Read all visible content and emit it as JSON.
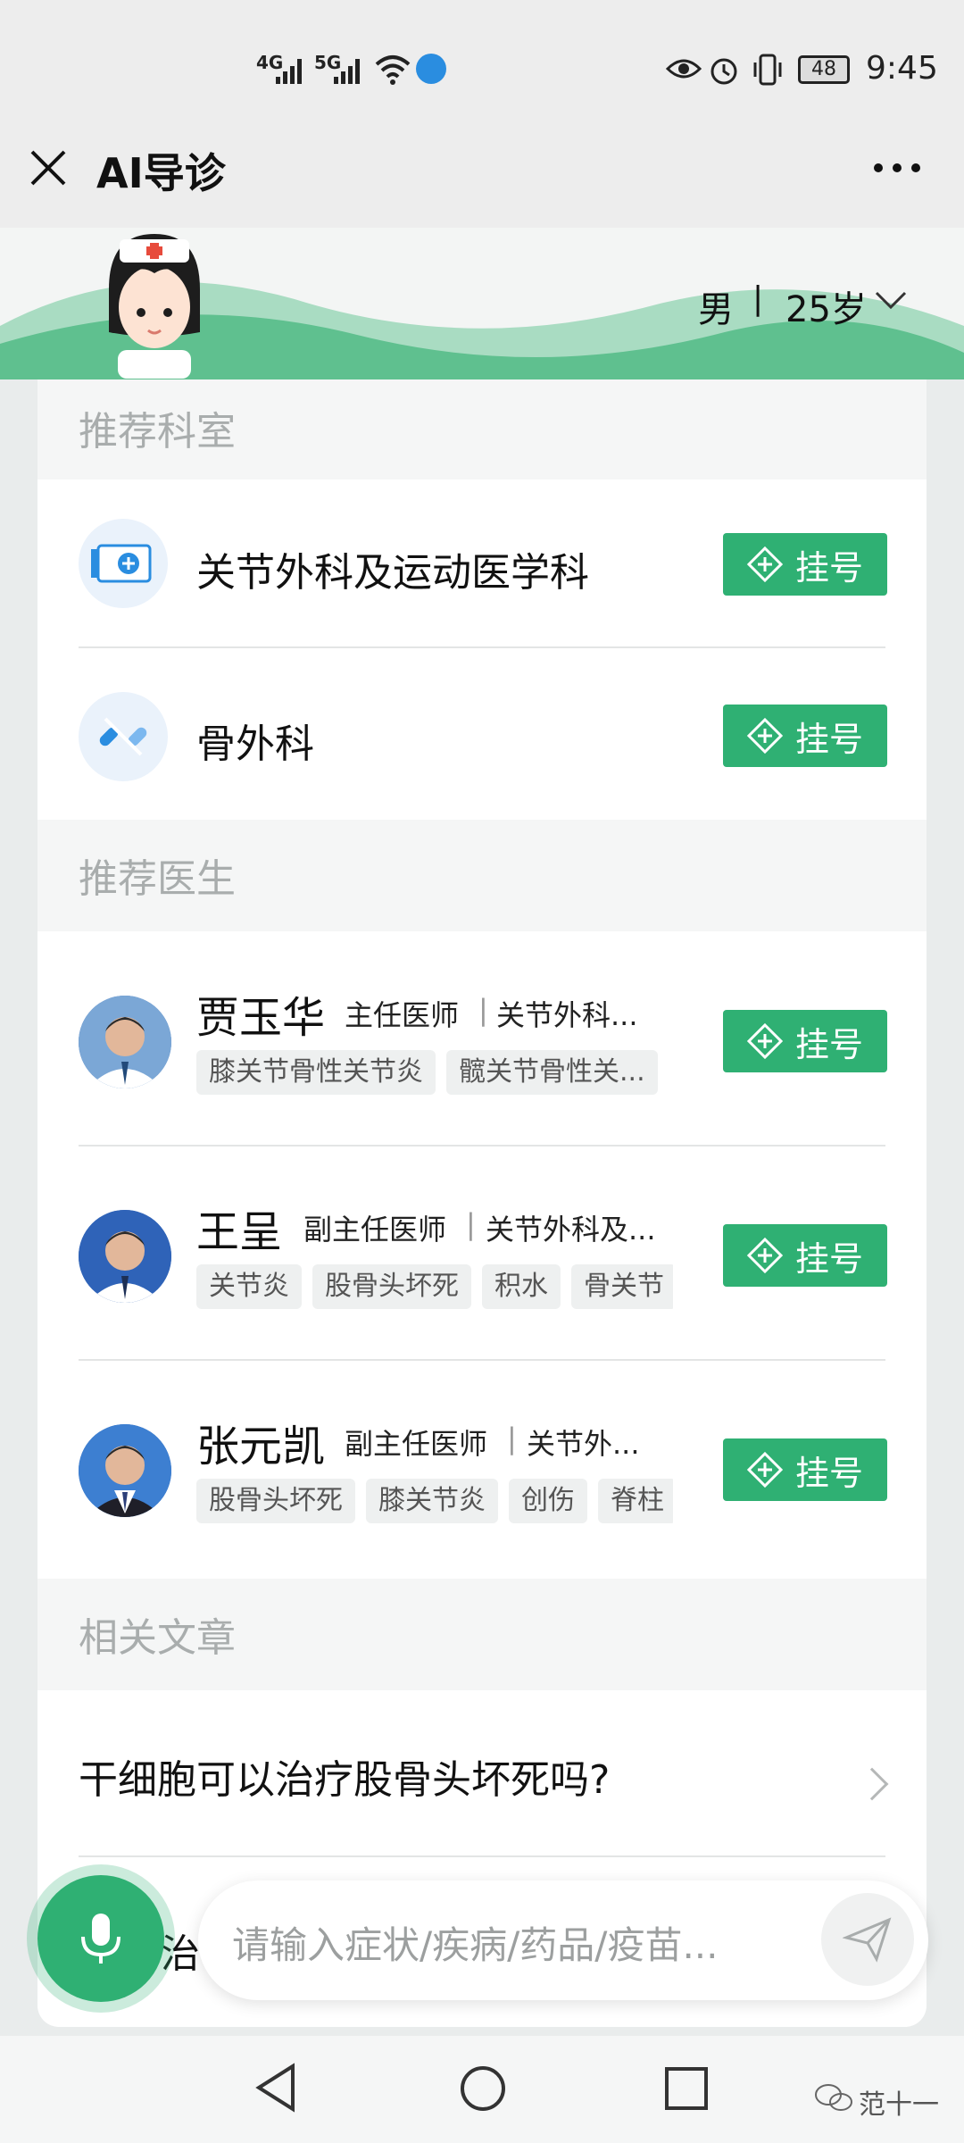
{
  "status_bar": {
    "signal_1": "4G",
    "signal_2": "5G",
    "battery": "48",
    "time": "9:45"
  },
  "header": {
    "title": "AI导诊"
  },
  "profile": {
    "gender": "男",
    "separator": "|",
    "age": "25岁"
  },
  "recommended_departments": {
    "heading": "推荐科室",
    "items": [
      {
        "name": "关节外科及运动医学科",
        "button": "挂号"
      },
      {
        "name": "骨外科",
        "button": "挂号"
      }
    ]
  },
  "recommended_doctors": {
    "heading": "推荐医生",
    "items": [
      {
        "name": "贾玉华",
        "title": "主任医师",
        "separator": "|",
        "dept": "关节外科...",
        "tags": [
          "膝关节骨性关节炎",
          "髋关节骨性关..."
        ],
        "button": "挂号"
      },
      {
        "name": "王呈",
        "title": "副主任医师",
        "separator": "|",
        "dept": "关节外科及...",
        "tags": [
          "关节炎",
          "股骨头坏死",
          "积水",
          "骨关节"
        ],
        "button": "挂号"
      },
      {
        "name": "张元凯",
        "title": "副主任医师",
        "separator": "|",
        "dept": "关节外...",
        "tags": [
          "股骨头坏死",
          "膝关节炎",
          "创伤",
          "脊柱"
        ],
        "button": "挂号"
      }
    ]
  },
  "related_articles": {
    "heading": "相关文章",
    "items": [
      {
        "title": "干细胞可以治疗股骨头坏死吗?"
      },
      {
        "title": "治"
      }
    ]
  },
  "input": {
    "placeholder": "请输入症状/疾病/药品/疫苗..."
  },
  "watermark": "范十一",
  "colors": {
    "accent": "#2fb073",
    "banner_wave": "#5fc08f",
    "section_label": "#a9adad"
  },
  "icons": {
    "close": "close-icon",
    "more": "more-icon",
    "register": "plus-diamond-icon",
    "mic": "microphone-icon",
    "send": "paper-plane-icon"
  }
}
